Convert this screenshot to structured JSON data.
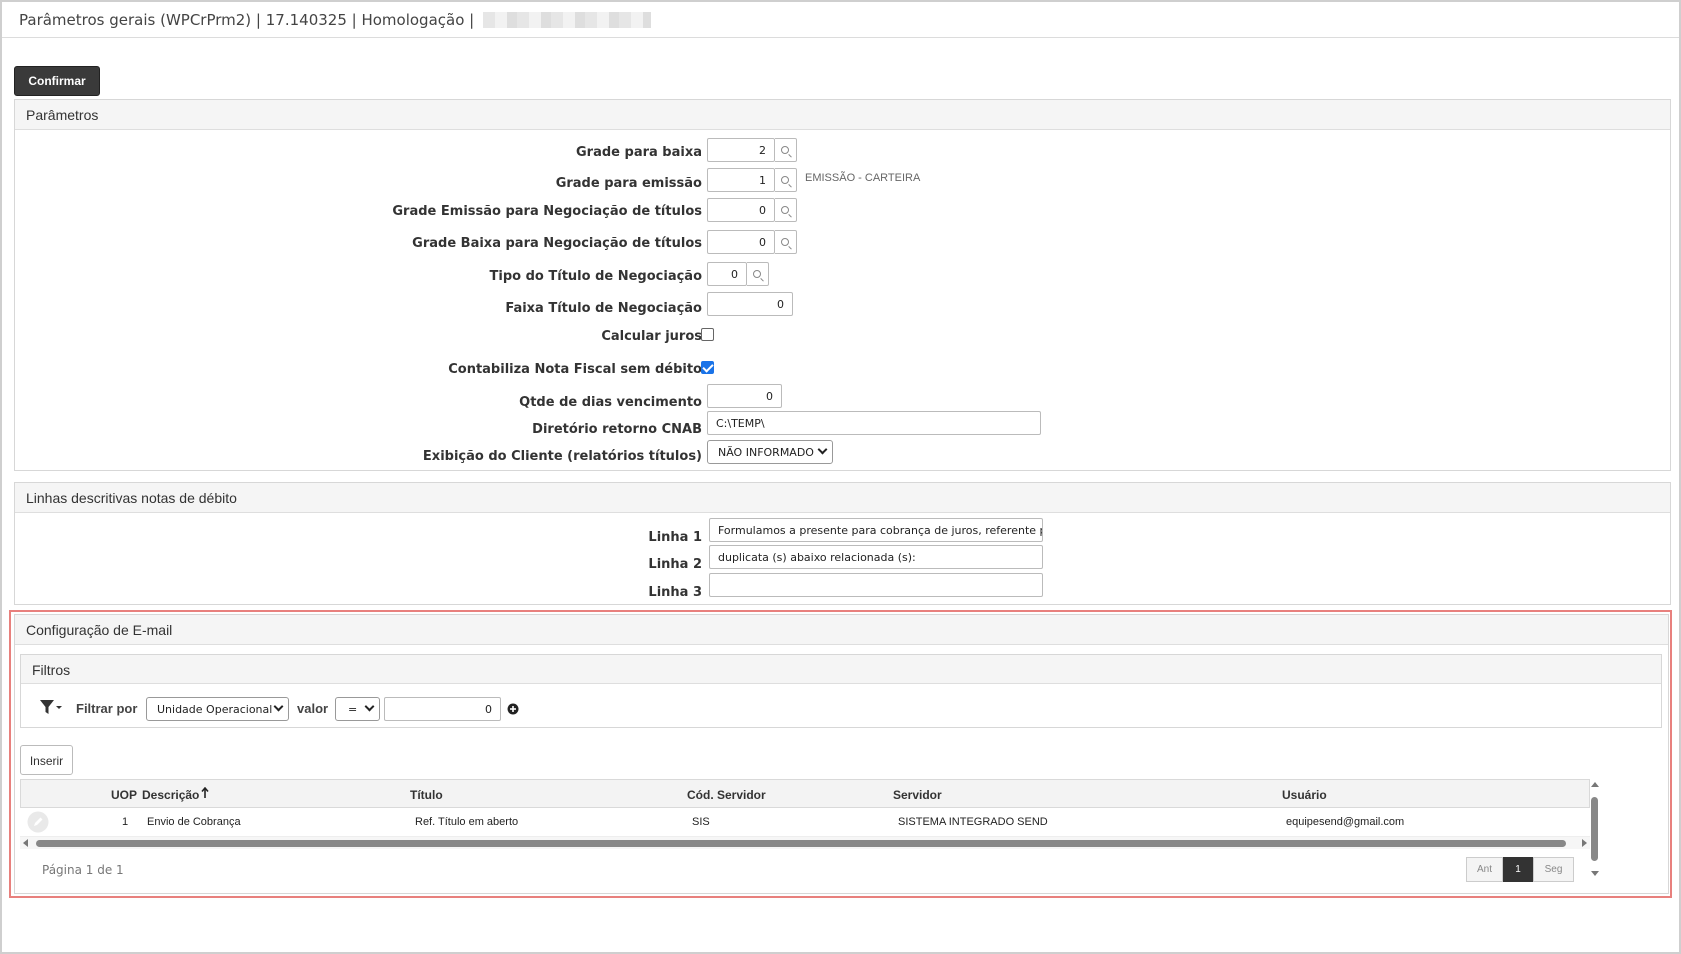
{
  "window": {
    "title": "Parâmetros gerais (WPCrPrm2) | 17.140325 | Homologação |"
  },
  "toolbar": {
    "confirm_label": "Confirmar"
  },
  "parametros": {
    "header": "Parâmetros",
    "fields": {
      "grade_baixa": {
        "label": "Grade para baixa",
        "value": "2"
      },
      "grade_emissao": {
        "label": "Grade para emissão",
        "value": "1",
        "hint": "EMISSÃO - CARTEIRA"
      },
      "grade_emissao_neg": {
        "label": "Grade Emissão para Negociação de títulos",
        "value": "0"
      },
      "grade_baixa_neg": {
        "label": "Grade Baixa para Negociação de títulos",
        "value": "0"
      },
      "tipo_titulo_neg": {
        "label": "Tipo do Título de Negociação",
        "value": "0"
      },
      "faixa_titulo_neg": {
        "label": "Faixa Título de Negociação",
        "value": "0"
      },
      "calcular_juros": {
        "label": "Calcular juros",
        "checked": false
      },
      "contabiliza_nf": {
        "label": "Contabiliza Nota Fiscal sem débito",
        "checked": true
      },
      "qtde_dias": {
        "label": "Qtde de dias vencimento",
        "value": "0"
      },
      "diretorio_cnab": {
        "label": "Diretório retorno CNAB",
        "value": "C:\\TEMP\\"
      },
      "exibicao_cliente": {
        "label": "Exibição do Cliente (relatórios títulos)",
        "value": "NÃO INFORMADO"
      }
    }
  },
  "linhas": {
    "header": "Linhas descritivas notas de débito",
    "linha1": {
      "label": "Linha 1",
      "value": "Formulamos a presente para cobrança de juros, referente pag"
    },
    "linha2": {
      "label": "Linha 2",
      "value": "duplicata (s) abaixo relacionada (s):"
    },
    "linha3": {
      "label": "Linha 3",
      "value": ""
    }
  },
  "email": {
    "header": "Configuração de E-mail",
    "filtros": {
      "header": "Filtros",
      "filtrar_por_label": "Filtrar por",
      "filtrar_por_value": "Unidade Operacional",
      "valor_label": "valor",
      "operator": "=",
      "valor_value": "0"
    },
    "insert_label": "Inserir",
    "columns": {
      "uop": "UOP",
      "descricao": "Descrição",
      "titulo": "Título",
      "cod_servidor": "Cód. Servidor",
      "servidor": "Servidor",
      "usuario": "Usuário"
    },
    "rows": [
      {
        "uop": "1",
        "descricao": "Envio de Cobrança",
        "titulo": "Ref. Título em aberto",
        "cod_servidor": "SIS",
        "servidor": "SISTEMA INTEGRADO SEND",
        "usuario": "equipesend@gmail.com"
      }
    ],
    "pager": {
      "info": "Página 1 de 1",
      "prev": "Ant",
      "current": "1",
      "next": "Seg"
    }
  },
  "icons": {
    "search": "magnifier-icon",
    "filter": "funnel-icon",
    "add": "plus-circle-icon",
    "edit": "pencil-icon",
    "sort": "arrow-up-icon"
  },
  "colors": {
    "confirm_bg": "#3a3a3a",
    "checkbox_on": "#1a73e8",
    "highlight_outline": "#e8807d"
  }
}
